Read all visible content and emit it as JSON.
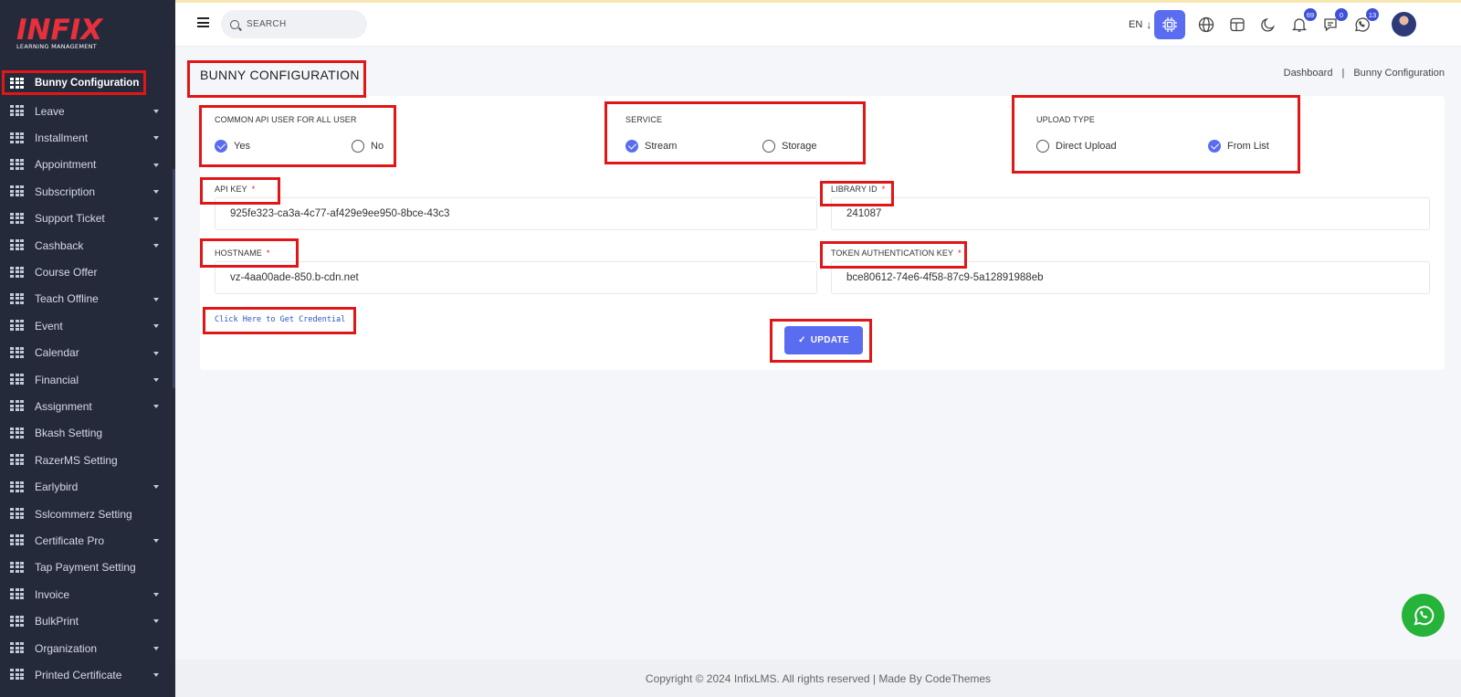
{
  "brand": {
    "name": "INFIX",
    "tagline": "LEARNING MANAGEMENT"
  },
  "sidebar": {
    "items": [
      {
        "label": "Bunny Configuration",
        "has_caret": false,
        "active": true
      },
      {
        "label": "Leave",
        "has_caret": true
      },
      {
        "label": "Installment",
        "has_caret": true
      },
      {
        "label": "Appointment",
        "has_caret": true
      },
      {
        "label": "Subscription",
        "has_caret": true
      },
      {
        "label": "Support Ticket",
        "has_caret": true
      },
      {
        "label": "Cashback",
        "has_caret": true
      },
      {
        "label": "Course Offer",
        "has_caret": false
      },
      {
        "label": "Teach Offline",
        "has_caret": true
      },
      {
        "label": "Event",
        "has_caret": true
      },
      {
        "label": "Calendar",
        "has_caret": true
      },
      {
        "label": "Financial",
        "has_caret": true
      },
      {
        "label": "Assignment",
        "has_caret": true
      },
      {
        "label": "Bkash Setting",
        "has_caret": false
      },
      {
        "label": "RazerMS Setting",
        "has_caret": false
      },
      {
        "label": "Earlybird",
        "has_caret": true
      },
      {
        "label": "Sslcommerz Setting",
        "has_caret": false
      },
      {
        "label": "Certificate Pro",
        "has_caret": true
      },
      {
        "label": "Tap Payment Setting",
        "has_caret": false
      },
      {
        "label": "Invoice",
        "has_caret": true
      },
      {
        "label": "BulkPrint",
        "has_caret": true
      },
      {
        "label": "Organization",
        "has_caret": true
      },
      {
        "label": "Printed Certificate",
        "has_caret": true
      }
    ]
  },
  "header": {
    "search_placeholder": "SEARCH",
    "language": "EN",
    "notifications_count": "69",
    "messages_count": "0",
    "whatsapp_count": "13"
  },
  "page": {
    "title": "BUNNY CONFIGURATION",
    "breadcrumb": [
      "Dashboard",
      "|",
      "Bunny Configuration"
    ]
  },
  "form": {
    "common_api": {
      "label": "COMMON API USER FOR ALL USER",
      "options": [
        "Yes",
        "No"
      ],
      "selected": "Yes"
    },
    "service": {
      "label": "SERVICE",
      "options": [
        "Stream",
        "Storage"
      ],
      "selected": "Stream"
    },
    "upload_type": {
      "label": "UPLOAD TYPE",
      "options": [
        "Direct Upload",
        "From List"
      ],
      "selected": "From List"
    },
    "api_key": {
      "label": "API KEY",
      "required": "*",
      "value": "925fe323-ca3a-4c77-af429e9ee950-8bce-43c3"
    },
    "library_id": {
      "label": "LIBRARY ID",
      "required": "*",
      "value": "241087"
    },
    "hostname": {
      "label": "HOSTNAME",
      "required": "*",
      "value": "vz-4aa00ade-850.b-cdn.net"
    },
    "token_key": {
      "label": "TOKEN AUTHENTICATION KEY",
      "required": "*",
      "value": "bce80612-74e6-4f58-87c9-5a12891988eb"
    },
    "credential_link": "Click Here to Get Credential",
    "update_button": "UPDATE"
  },
  "footer": {
    "text": "Copyright © 2024 InfixLMS. All rights reserved | Made By CodeThemes"
  },
  "colors": {
    "accent": "#5a6df0",
    "sidebar_bg": "#252a3b",
    "highlight": "#e11616",
    "whatsapp": "#25b33a"
  }
}
